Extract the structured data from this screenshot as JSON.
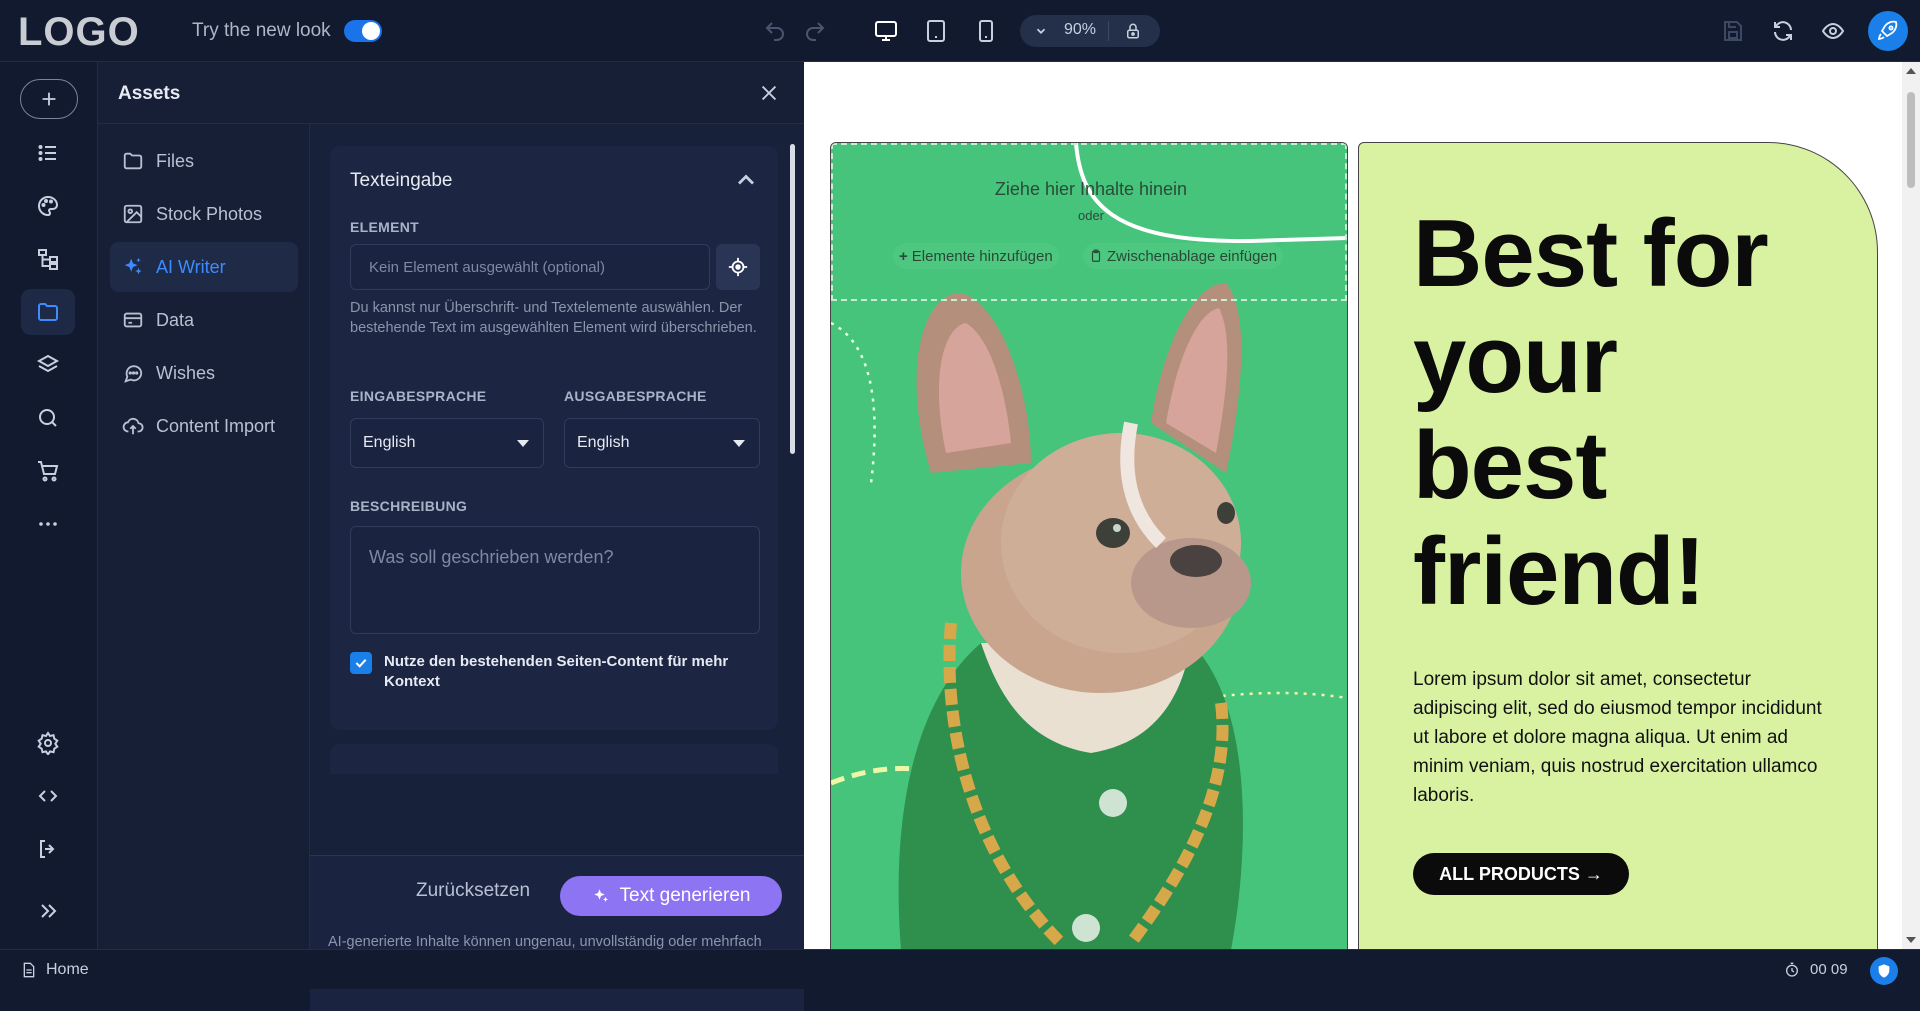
{
  "topbar": {
    "logo": "LOGO",
    "try_label": "Try the new look",
    "zoom": "90%"
  },
  "colors": {
    "accent": "#1a7fe8",
    "generate": "#8c74f2",
    "hero_bg": "#d9f2a2",
    "photo_bg": "#46c47b"
  },
  "panel": {
    "title": "Assets",
    "nav": [
      {
        "label": "Files",
        "icon": "folder-icon"
      },
      {
        "label": "Stock Photos",
        "icon": "image-icon"
      },
      {
        "label": "AI Writer",
        "icon": "sparkle-icon"
      },
      {
        "label": "Data",
        "icon": "card-icon"
      },
      {
        "label": "Wishes",
        "icon": "chat-bubble-icon"
      },
      {
        "label": "Content Import",
        "icon": "cloud-upload-icon"
      }
    ],
    "active_nav": "AI Writer"
  },
  "writer": {
    "section_title": "Texteingabe",
    "element_label": "ELEMENT",
    "element_placeholder": "Kein Element ausgewählt (optional)",
    "element_hint": "Du kannst nur Überschrift- und Textelemente auswählen. Der bestehende Text im ausgewählten Element wird überschrieben.",
    "input_lang_label": "EINGABESPRACHE",
    "input_lang_value": "English",
    "output_lang_label": "AUSGABESPRACHE",
    "output_lang_value": "English",
    "description_label": "BESCHREIBUNG",
    "description_placeholder": "Was soll geschrieben werden?",
    "context_checkbox_label": "Nutze den bestehenden Seiten-Content für mehr Kontext",
    "context_checked": true,
    "reset_label": "Zurücksetzen",
    "generate_label": "Text generieren",
    "disclaimer": "AI-generierte Inhalte können ungenau, unvollständig oder mehrfach vorkommen; ähnliche oder identische Inhalte können anderen Usern angezeigt werden"
  },
  "canvas": {
    "dropzone_title": "Ziehe hier Inhalte hinein",
    "dropzone_or": "oder",
    "add_elements_label": "Elemente hinzufügen",
    "paste_clipboard_label": "Zwischenablage einfügen",
    "hero_title": "Best for your best friend!",
    "hero_text": "Lorem ipsum dolor sit amet, consectetur adipiscing elit, sed do eiusmod tempor incididunt ut labore et dolore magna aliqua. Ut enim ad minim veniam, quis nostrud exercitation ullamco laboris.",
    "hero_button": "ALL PRODUCTS →"
  },
  "statusbar": {
    "page": "Home",
    "timer": "00 09"
  }
}
